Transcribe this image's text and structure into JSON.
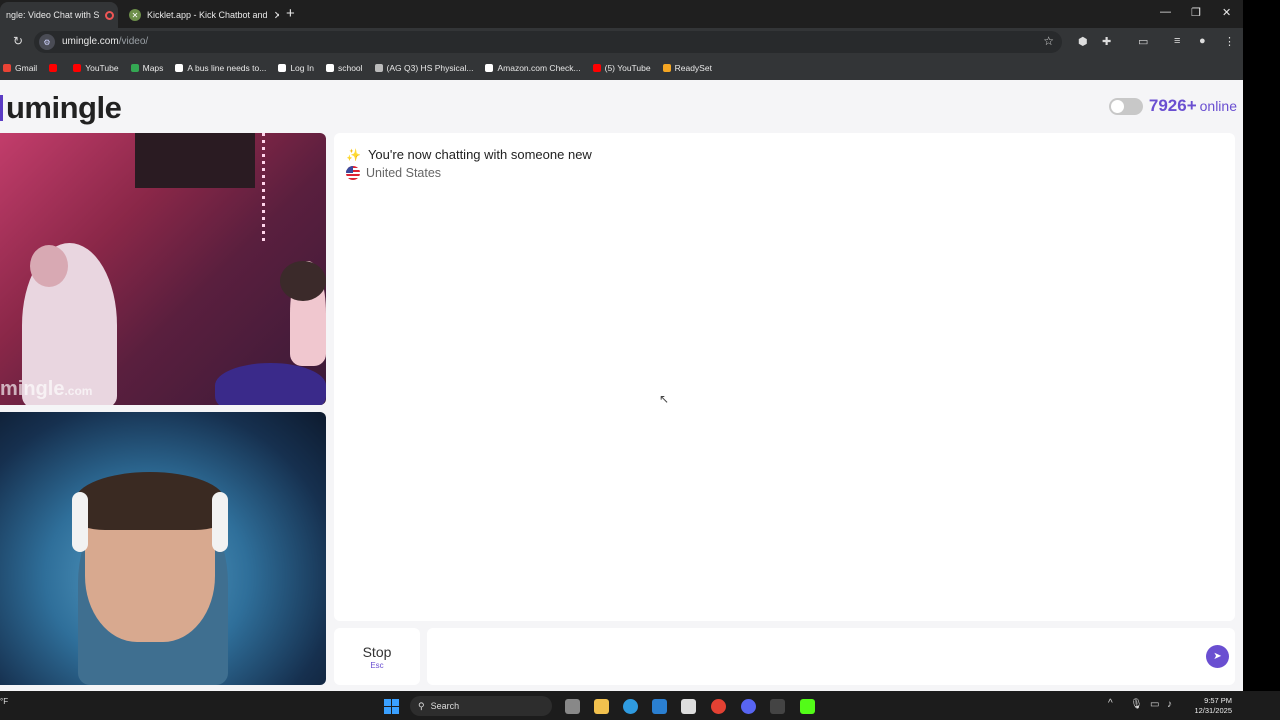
{
  "browser": {
    "tabs": [
      {
        "title": "ngle: Video Chat with S",
        "active": true
      },
      {
        "title": "Kicklet.app - Kick Chatbot and",
        "active": false
      }
    ],
    "address": {
      "domain": "umingle.com",
      "path": "/video/"
    },
    "bookmarks": [
      {
        "label": "Gmail",
        "icon": "gmail-icon",
        "color": "#ea4335"
      },
      {
        "label": "",
        "icon": "youtube-icon",
        "color": "#ff0000"
      },
      {
        "label": "YouTube",
        "icon": "youtube-icon",
        "color": "#ff0000"
      },
      {
        "label": "Maps",
        "icon": "maps-icon",
        "color": "#34a853"
      },
      {
        "label": "A bus line needs to...",
        "icon": "doc-icon",
        "color": "#ffffff"
      },
      {
        "label": "Log In",
        "icon": "grid-icon",
        "color": "#ffffff"
      },
      {
        "label": "school",
        "icon": "grid-icon",
        "color": "#ffffff"
      },
      {
        "label": "(AG Q3) HS Physical...",
        "icon": "globe-icon",
        "color": "#bbbbbb"
      },
      {
        "label": "Amazon.com Check...",
        "icon": "amazon-icon",
        "color": "#ffffff"
      },
      {
        "label": "(5) YouTube",
        "icon": "youtube-icon",
        "color": "#ff0000"
      },
      {
        "label": "ReadySet",
        "icon": "readyset-icon",
        "color": "#f5a623"
      }
    ]
  },
  "site": {
    "logo": "umingle",
    "online_count": "7926+",
    "online_label": "online",
    "watermark_main": "mingle",
    "watermark_suffix": ".com"
  },
  "chat": {
    "message": "You're now chatting with someone new",
    "country": "United States",
    "input_placeholder": ""
  },
  "controls": {
    "stop_label": "Stop",
    "stop_shortcut": "Esc"
  },
  "taskbar": {
    "weather": "°F",
    "search_label": "Search",
    "time": "9:57 PM",
    "date": "12/31/2025"
  },
  "colors": {
    "brand": "#6a4fd1",
    "chrome_dark": "#1f1f1f"
  }
}
